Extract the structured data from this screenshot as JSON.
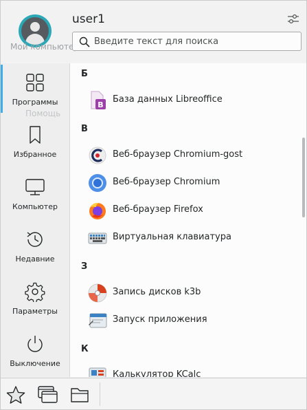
{
  "header": {
    "username": "user1",
    "search": {
      "placeholder": "Введите текст для поиска",
      "value": ""
    },
    "ghost_labels": [
      "Мой компьютер",
      "Помощь"
    ]
  },
  "sidebar": {
    "items": [
      {
        "label": "Программы",
        "icon": "apps-grid-icon",
        "active": true
      },
      {
        "label": "Избранное",
        "icon": "bookmark-icon",
        "active": false
      },
      {
        "label": "Компьютер",
        "icon": "computer-icon",
        "active": false
      },
      {
        "label": "Недавние",
        "icon": "history-icon",
        "active": false
      },
      {
        "label": "Параметры",
        "icon": "gear-icon",
        "active": false
      },
      {
        "label": "Выключение",
        "icon": "power-icon",
        "active": false
      }
    ]
  },
  "app_list": {
    "sections": [
      {
        "letter": "Б",
        "apps": [
          {
            "name": "База данных Libreoffice",
            "icon": "libreoffice-base-icon"
          }
        ]
      },
      {
        "letter": "В",
        "apps": [
          {
            "name": "Веб-браузер Chromium-gost",
            "icon": "chromium-gost-icon"
          },
          {
            "name": "Веб-браузер Chromium",
            "icon": "chromium-icon"
          },
          {
            "name": "Веб-браузер Firefox",
            "icon": "firefox-icon"
          },
          {
            "name": "Виртуальная клавиатура",
            "icon": "keyboard-icon"
          }
        ]
      },
      {
        "letter": "З",
        "apps": [
          {
            "name": "Запись дисков k3b",
            "icon": "k3b-icon"
          },
          {
            "name": "Запуск приложения",
            "icon": "run-app-icon"
          }
        ]
      },
      {
        "letter": "К",
        "apps": [
          {
            "name": "Калькулятор KCalc",
            "icon": "kcalc-icon"
          }
        ]
      }
    ]
  },
  "bottom_tabs": [
    {
      "icon": "favorites-star-icon"
    },
    {
      "icon": "applications-windows-icon"
    },
    {
      "icon": "folder-icon"
    }
  ],
  "colors": {
    "accent": "#3daee9",
    "avatar_ring": "#2aa8b6"
  }
}
